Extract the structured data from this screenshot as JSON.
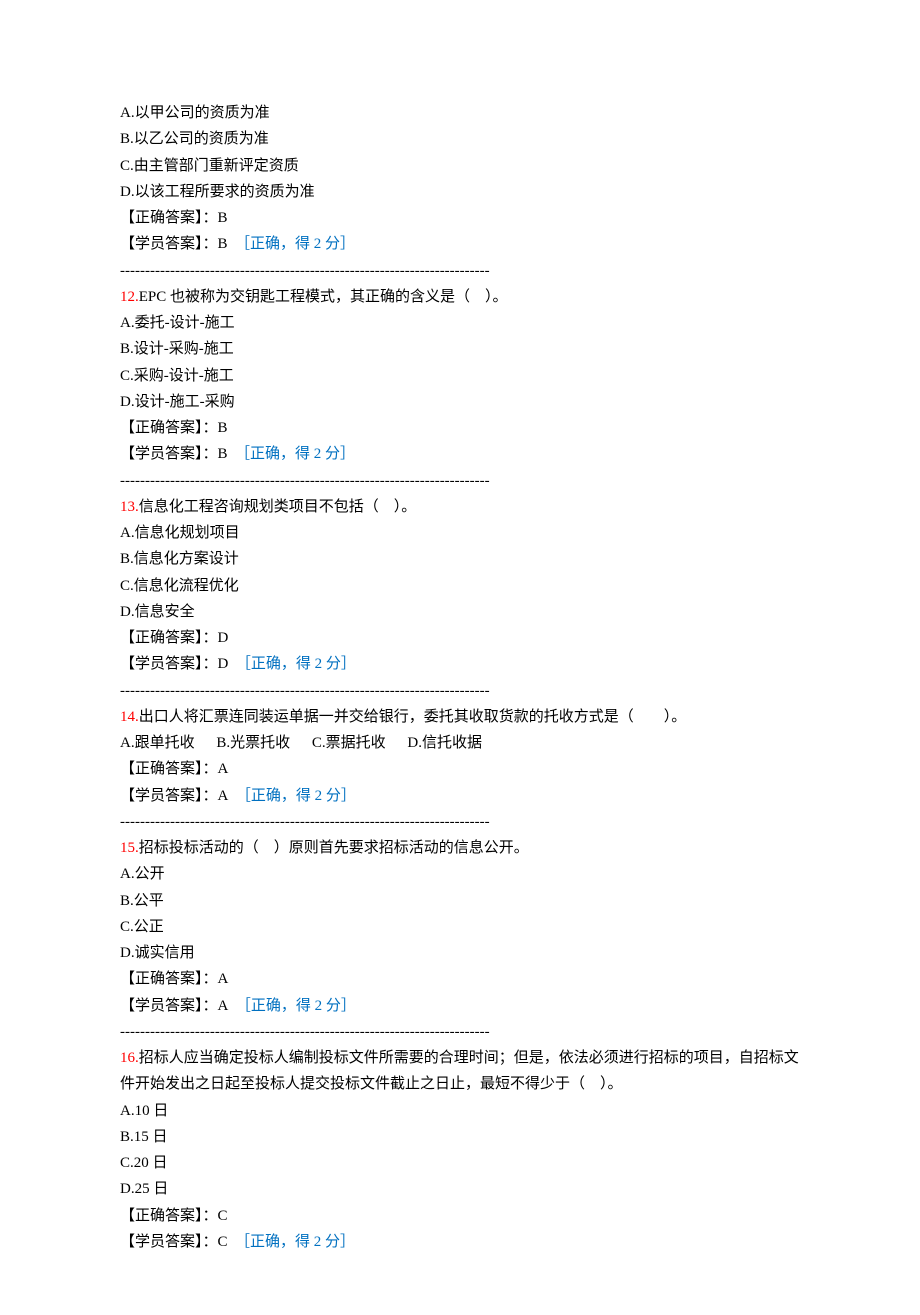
{
  "divider": "--------------------------------------------------------------------------",
  "questions": [
    {
      "num": "",
      "stem": "",
      "opts": [
        "A.以甲公司的资质为准",
        "B.以乙公司的资质为准",
        "C.由主管部门重新评定资质",
        "D.以该工程所要求的资质为准"
      ],
      "correct_label": "【正确答案】：",
      "correct": "B",
      "student_label": "【学员答案】：",
      "student": "B",
      "feedback": "［正确，得 2 分］"
    },
    {
      "num": "12.",
      "stem": "EPC 也被称为交钥匙工程模式，其正确的含义是（　）。",
      "opts": [
        "A.委托-设计-施工",
        "B.设计-采购-施工",
        "C.采购-设计-施工",
        "D.设计-施工-采购"
      ],
      "correct_label": "【正确答案】：",
      "correct": "B",
      "student_label": "【学员答案】：",
      "student": "B",
      "feedback": "［正确，得 2 分］"
    },
    {
      "num": "13.",
      "stem": "信息化工程咨询规划类项目不包括（　）。",
      "opts": [
        "A.信息化规划项目",
        "B.信息化方案设计",
        "C.信息化流程优化",
        "D.信息安全"
      ],
      "correct_label": "【正确答案】：",
      "correct": "D",
      "student_label": "【学员答案】：",
      "student": "D",
      "feedback": "［正确，得 2 分］"
    },
    {
      "num": "14.",
      "stem": "出口人将汇票连同装运单据一并交给银行，委托其收取货款的托收方式是（　　）。",
      "opts_inline": [
        "A.跟单托收",
        "B.光票托收",
        "C.票据托收",
        "D.信托收据"
      ],
      "correct_label": "【正确答案】：",
      "correct": "A",
      "student_label": "【学员答案】：",
      "student": "A",
      "feedback": "［正确，得 2 分］"
    },
    {
      "num": "15.",
      "stem": "招标投标活动的（　）原则首先要求招标活动的信息公开。",
      "opts": [
        "A.公开",
        "B.公平",
        "C.公正",
        "D.诚实信用"
      ],
      "correct_label": "【正确答案】：",
      "correct": "A",
      "student_label": "【学员答案】：",
      "student": "A",
      "feedback": "［正确，得 2 分］"
    },
    {
      "num": "16.",
      "stem": "招标人应当确定投标人编制投标文件所需要的合理时间；但是，依法必须进行招标的项目，自招标文件开始发出之日起至投标人提交投标文件截止之日止，最短不得少于（　）。",
      "opts": [
        "A.10 日",
        "B.15 日",
        "C.20 日",
        "D.25 日"
      ],
      "correct_label": "【正确答案】：",
      "correct": "C",
      "student_label": "【学员答案】：",
      "student": "C",
      "feedback": "［正确，得 2 分］"
    }
  ]
}
